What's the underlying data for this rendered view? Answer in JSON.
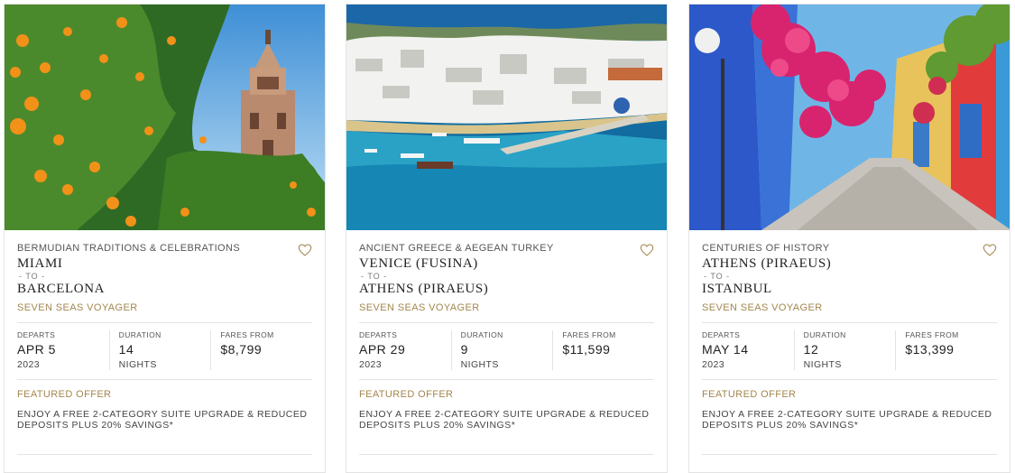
{
  "cards": [
    {
      "voyage_name": "BERMUDIAN TRADITIONS & CELEBRATIONS",
      "from_port": "MIAMI",
      "to_label": "- TO -",
      "to_port": "BARCELONA",
      "ship": "SEVEN SEAS VOYAGER",
      "departs_label": "DEPARTS",
      "departs_date": "APR 5",
      "departs_year": "2023",
      "duration_label": "DURATION",
      "duration_value": "14",
      "duration_unit": "NIGHTS",
      "fares_label": "FARES FROM",
      "fares_value": "$8,799",
      "offer_title": "FEATURED OFFER",
      "offer_text": "ENJOY A FREE 2-CATEGORY SUITE UPGRADE & REDUCED DEPOSITS PLUS 20% SAVINGS*",
      "image_icon": "seville-oranges-tower-photo"
    },
    {
      "voyage_name": "ANCIENT GREECE & AEGEAN TURKEY",
      "from_port": "VENICE (FUSINA)",
      "to_label": "- TO -",
      "to_port": "ATHENS (PIRAEUS)",
      "ship": "SEVEN SEAS VOYAGER",
      "departs_label": "DEPARTS",
      "departs_date": "APR 29",
      "departs_year": "2023",
      "duration_label": "DURATION",
      "duration_value": "9",
      "duration_unit": "NIGHTS",
      "fares_label": "FARES FROM",
      "fares_value": "$11,599",
      "offer_title": "FEATURED OFFER",
      "offer_text": "ENJOY A FREE 2-CATEGORY SUITE UPGRADE & REDUCED DEPOSITS PLUS 20% SAVINGS*",
      "image_icon": "mykonos-harbor-photo"
    },
    {
      "voyage_name": "CENTURIES OF HISTORY",
      "from_port": "ATHENS (PIRAEUS)",
      "to_label": "- TO -",
      "to_port": "ISTANBUL",
      "ship": "SEVEN SEAS VOYAGER",
      "departs_label": "DEPARTS",
      "departs_date": "MAY 14",
      "departs_year": "2023",
      "duration_label": "DURATION",
      "duration_value": "12",
      "duration_unit": "NIGHTS",
      "fares_label": "FARES FROM",
      "fares_value": "$13,399",
      "offer_title": "FEATURED OFFER",
      "offer_text": "ENJOY A FREE 2-CATEGORY SUITE UPGRADE & REDUCED DEPOSITS PLUS 20% SAVINGS*",
      "image_icon": "colorful-street-flowers-photo"
    }
  ],
  "icons": {
    "favorite": "heart-outline-icon"
  },
  "colors": {
    "accent_gold": "#a3874e",
    "divider": "#e3e3e3"
  }
}
